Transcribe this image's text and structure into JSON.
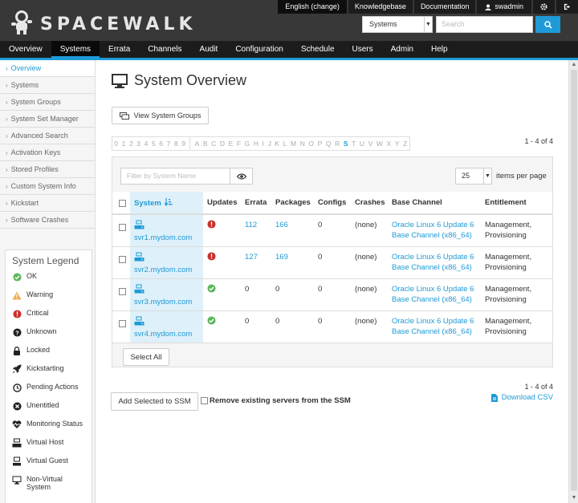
{
  "header": {
    "brand": "SPACEWALK",
    "language_label": "English (change)",
    "knowledgebase_label": "Knowledgebase",
    "documentation_label": "Documentation",
    "user_name": "swadmin",
    "search_scope": "Systems",
    "search_placeholder": "Search"
  },
  "nav": {
    "items": [
      "Overview",
      "Systems",
      "Errata",
      "Channels",
      "Audit",
      "Configuration",
      "Schedule",
      "Users",
      "Admin",
      "Help"
    ],
    "active": "Systems"
  },
  "sidebar": {
    "items": [
      "Overview",
      "Systems",
      "System Groups",
      "System Set Manager",
      "Advanced Search",
      "Activation Keys",
      "Stored Profiles",
      "Custom System Info",
      "Kickstart",
      "Software Crashes"
    ],
    "active": "Overview"
  },
  "legend": {
    "title": "System Legend",
    "items": [
      {
        "label": "OK",
        "icon": "ok-icon"
      },
      {
        "label": "Warning",
        "icon": "warning-icon"
      },
      {
        "label": "Critical",
        "icon": "critical-icon"
      },
      {
        "label": "Unknown",
        "icon": "unknown-icon"
      },
      {
        "label": "Locked",
        "icon": "lock-icon"
      },
      {
        "label": "Kickstarting",
        "icon": "rocket-icon"
      },
      {
        "label": "Pending Actions",
        "icon": "clock-icon"
      },
      {
        "label": "Unentitled",
        "icon": "unentitled-icon"
      },
      {
        "label": "Monitoring Status",
        "icon": "monitoring-icon"
      },
      {
        "label": "Virtual Host",
        "icon": "virtual-host-icon"
      },
      {
        "label": "Virtual Guest",
        "icon": "virtual-guest-icon"
      },
      {
        "label": "Non-Virtual System",
        "icon": "non-virtual-icon"
      }
    ]
  },
  "main": {
    "title": "System Overview",
    "view_groups_label": "View System Groups",
    "count_label": "1 - 4 of 4",
    "alphabet": [
      "0",
      "1",
      "2",
      "3",
      "4",
      "5",
      "6",
      "7",
      "8",
      "9",
      "A",
      "B",
      "C",
      "D",
      "E",
      "F",
      "G",
      "H",
      "I",
      "J",
      "K",
      "L",
      "M",
      "N",
      "O",
      "P",
      "Q",
      "R",
      "S",
      "T",
      "U",
      "V",
      "W",
      "X",
      "Y",
      "Z"
    ],
    "alphabet_active": "S",
    "filter_placeholder": "Filter by System Name",
    "per_page_value": "25",
    "per_page_label": "items per page",
    "columns": [
      "System",
      "Updates",
      "Errata",
      "Packages",
      "Configs",
      "Crashes",
      "Base Channel",
      "Entitlement"
    ],
    "rows": [
      {
        "system": "svr1.mydom.com",
        "status": "critical",
        "errata": "112",
        "packages": "166",
        "configs": "0",
        "crashes": "(none)",
        "channel_1": "Oracle Linux 6 Update 6",
        "channel_2": "Base Channel (x86_64)",
        "ent_1": "Management,",
        "ent_2": "Provisioning"
      },
      {
        "system": "svr2.mydom.com",
        "status": "critical",
        "errata": "127",
        "packages": "169",
        "configs": "0",
        "crashes": "(none)",
        "channel_1": "Oracle Linux 6 Update 6",
        "channel_2": "Base Channel (x86_64)",
        "ent_1": "Management,",
        "ent_2": "Provisioning"
      },
      {
        "system": "svr3.mydom.com",
        "status": "ok",
        "errata": "0",
        "packages": "0",
        "configs": "0",
        "crashes": "(none)",
        "channel_1": "Oracle Linux 6 Update 6",
        "channel_2": "Base Channel (x86_64)",
        "ent_1": "Management,",
        "ent_2": "Provisioning"
      },
      {
        "system": "svr4.mydom.com",
        "status": "ok",
        "errata": "0",
        "packages": "0",
        "configs": "0",
        "crashes": "(none)",
        "channel_1": "Oracle Linux 6 Update 6",
        "channel_2": "Base Channel (x86_64)",
        "ent_1": "Management,",
        "ent_2": "Provisioning"
      }
    ],
    "select_all_label": "Select All",
    "add_ssm_label": "Add Selected to SSM",
    "remove_ssm_label": "Remove existing servers from the SSM",
    "download_csv_label": "Download CSV"
  },
  "colors": {
    "accent": "#1e9ad6",
    "header_bg": "#383838",
    "nav_bg": "#1c1c1c",
    "ok": "#5cb85c",
    "warning": "#f0ad4e",
    "critical": "#c9302c"
  }
}
